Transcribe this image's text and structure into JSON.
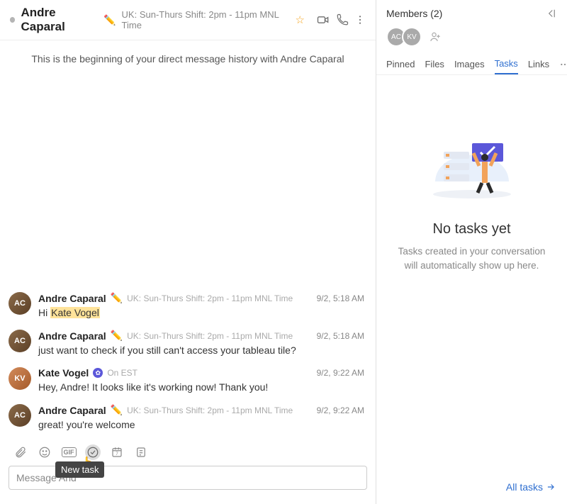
{
  "header": {
    "name": "Andre Caparal",
    "status_emoji": "✏️",
    "status_text": "UK: Sun-Thurs Shift: 2pm - 11pm MNL Time"
  },
  "begin_text": "This is the beginning of your direct message history with Andre Caparal",
  "messages": [
    {
      "author": "Andre Caparal",
      "emoji": "✏️",
      "status": "UK: Sun-Thurs Shift: 2pm - 11pm MNL Time",
      "time": "9/2, 5:18 AM",
      "text_prefix": "Hi ",
      "mention": "Kate Vogel",
      "avatar": "av1"
    },
    {
      "author": "Andre Caparal",
      "emoji": "✏️",
      "status": "UK: Sun-Thurs Shift: 2pm - 11pm MNL Time",
      "time": "9/2, 5:18 AM",
      "text": "just want to check if you still can't access your tableau tile?",
      "avatar": "av1"
    },
    {
      "author": "Kate Vogel",
      "badge": "blue",
      "status": "On EST",
      "time": "9/2, 9:22 AM",
      "text": "Hey, Andre! It looks like it's working now! Thank you!",
      "avatar": "av2"
    },
    {
      "author": "Andre Caparal",
      "emoji": "✏️",
      "status": "UK: Sun-Thurs Shift: 2pm - 11pm MNL Time",
      "time": "9/2, 9:22 AM",
      "text": "great! you're welcome",
      "avatar": "av1"
    }
  ],
  "composer": {
    "tooltip": "New task",
    "placeholder": "Message And"
  },
  "side": {
    "members_label": "Members (2)",
    "tabs": [
      "Pinned",
      "Files",
      "Images",
      "Tasks",
      "Links"
    ],
    "active_tab": "Tasks",
    "empty_title": "No tasks yet",
    "empty_desc": "Tasks created in your conversation will automatically show up here.",
    "all_tasks": "All tasks"
  }
}
